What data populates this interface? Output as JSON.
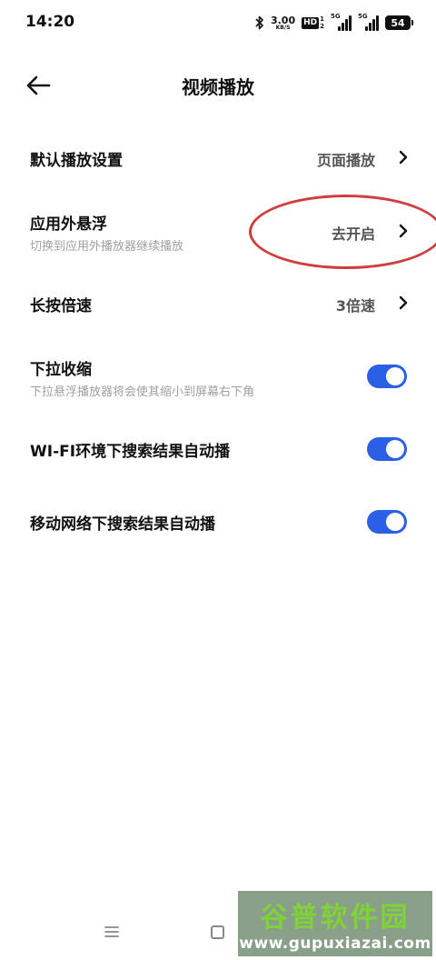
{
  "status_bar": {
    "time": "14:20",
    "speed_value": "3.00",
    "speed_unit": "KB/S",
    "hd_label": "HD",
    "hd_nums": [
      "1",
      "2"
    ],
    "signal_label": "5G",
    "battery": "54"
  },
  "header": {
    "title": "视频播放",
    "back_icon": "arrow-left-icon"
  },
  "settings": [
    {
      "title": "默认播放设置",
      "value": "页面播放"
    },
    {
      "title": "应用外悬浮",
      "subtitle": "切换到应用外播放器继续播放",
      "value": "去开启"
    },
    {
      "title": "长按倍速",
      "value": "3倍速"
    },
    {
      "title": "下拉收缩",
      "subtitle": "下拉悬浮播放器将会使其缩小到屏幕右下角",
      "toggle_on": true
    },
    {
      "title": "WI-FI环境下搜索结果自动播",
      "toggle_on": true
    },
    {
      "title": "移动网络下搜索结果自动播",
      "toggle_on": true
    }
  ],
  "colors": {
    "toggle_on": "#2a5fe6",
    "annotation": "#cf3d3d"
  },
  "watermark": {
    "logo": "谷普软件园",
    "url": "www.gupuxiazai.com"
  }
}
